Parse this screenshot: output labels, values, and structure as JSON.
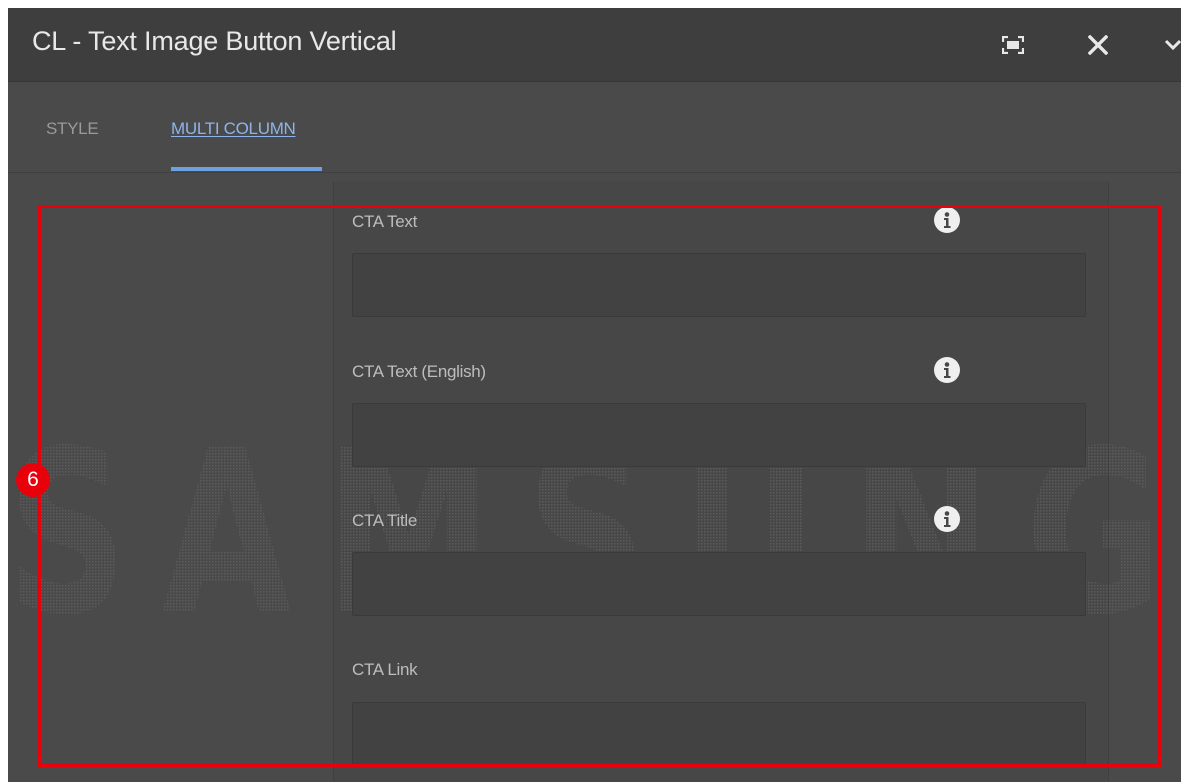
{
  "dialog": {
    "title": "CL - Text Image Button Vertical",
    "header_icons": [
      "fullscreen-icon",
      "close-icon",
      "chevron-down-icon"
    ]
  },
  "tabs": [
    {
      "label": "STYLE",
      "active": false
    },
    {
      "label": "MULTI COLUMN",
      "active": true
    }
  ],
  "fields": [
    {
      "label": "CTA Text",
      "value": "",
      "info_icon": true
    },
    {
      "label": "CTA Text (English)",
      "value": "",
      "info_icon": true
    },
    {
      "label": "CTA Title",
      "value": "",
      "info_icon": true
    },
    {
      "label": "CTA Link",
      "value": "",
      "info_icon": false
    }
  ],
  "annotation": {
    "step_number": "6",
    "color": "#e8000b"
  },
  "watermark": {
    "text": "SAMSUNG"
  },
  "colors": {
    "header_bg": "#3e3e3e",
    "panel_bg": "#4a4a4a",
    "active_tab": "#8db4ea",
    "tab_indicator": "#6e9fe0"
  }
}
